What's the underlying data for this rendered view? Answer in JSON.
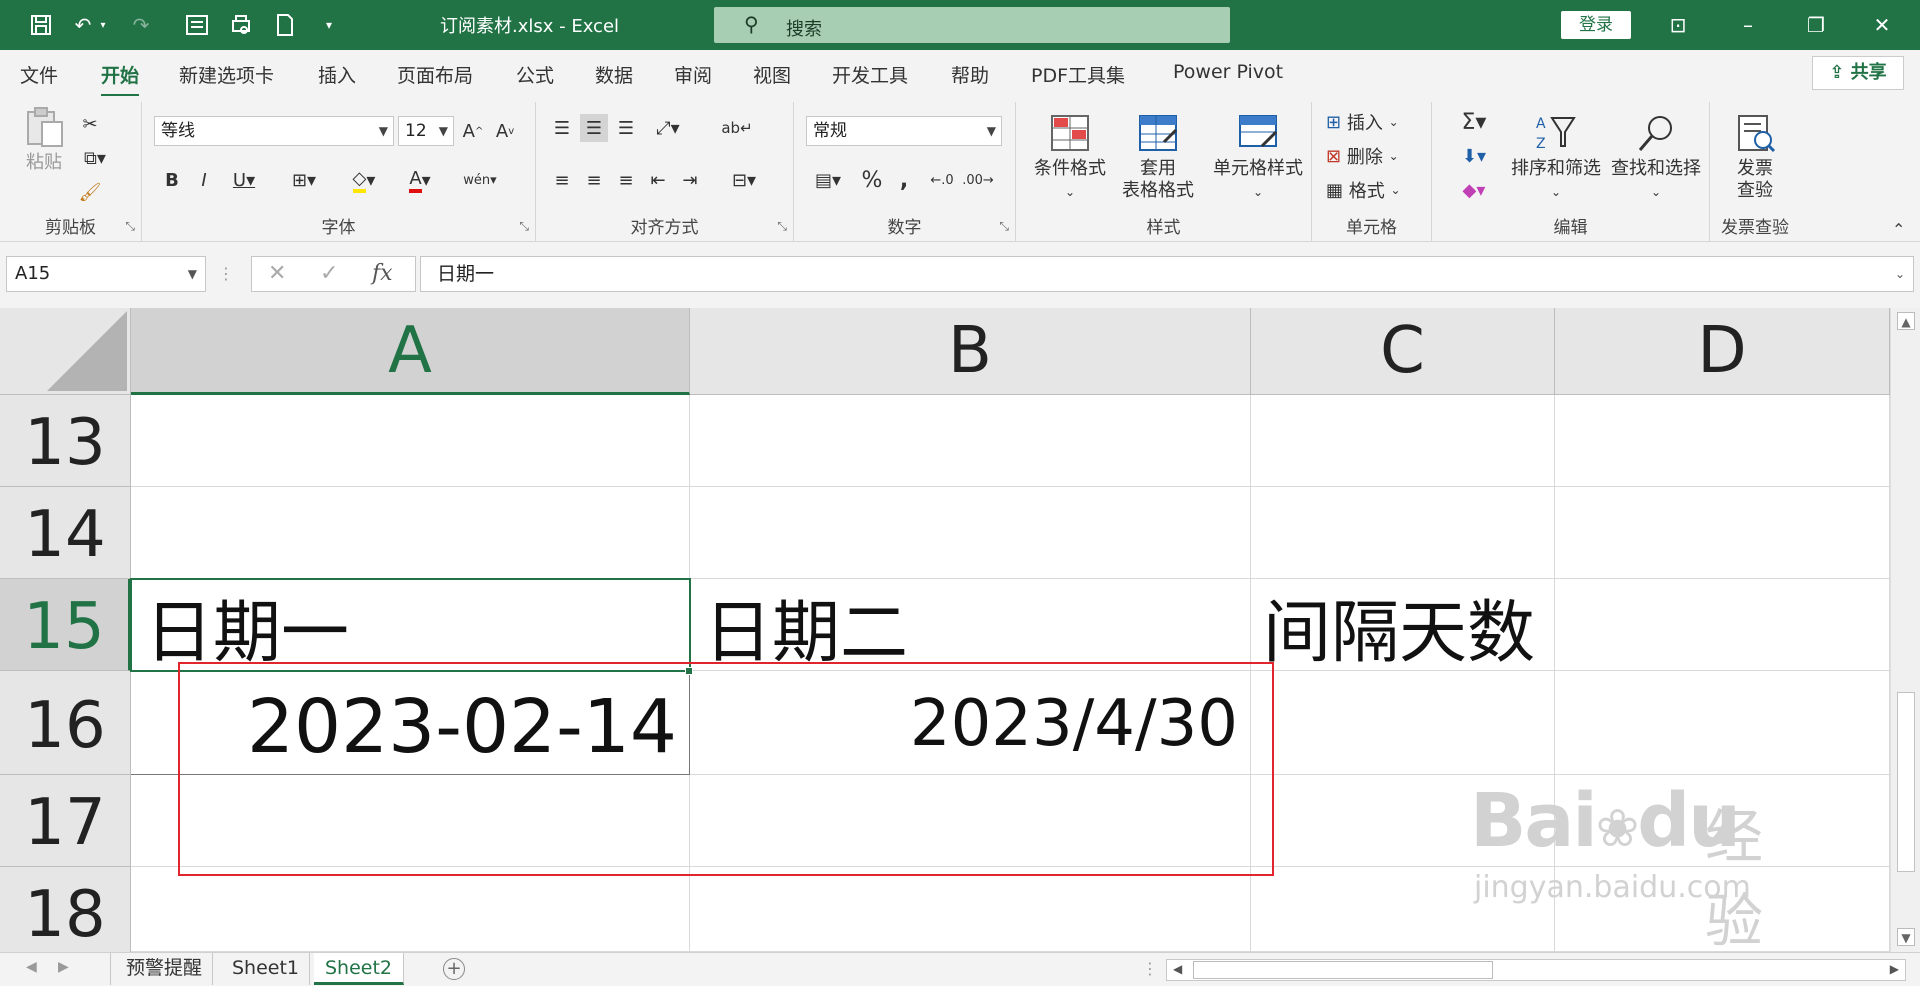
{
  "title_bar": {
    "title": "订阅素材.xlsx  -  Excel",
    "search_placeholder": "搜索",
    "login_label": "登录"
  },
  "menu": {
    "tabs": [
      "文件",
      "开始",
      "新建选项卡",
      "插入",
      "页面布局",
      "公式",
      "数据",
      "审阅",
      "视图",
      "开发工具",
      "帮助",
      "PDF工具集",
      "Power Pivot"
    ],
    "active_tab": "开始",
    "share_label": "共享"
  },
  "ribbon": {
    "clipboard": {
      "label": "剪贴板",
      "paste_label": "粘贴"
    },
    "font": {
      "label": "字体",
      "font_name": "等线",
      "font_size": "12"
    },
    "alignment": {
      "label": "对齐方式"
    },
    "number": {
      "label": "数字",
      "format": "常规"
    },
    "styles": {
      "label": "样式",
      "conditional_format": "条件格式",
      "table_format_line1": "套用",
      "table_format_line2": "表格格式",
      "cell_styles": "单元格样式"
    },
    "cells": {
      "label": "单元格",
      "insert": "插入",
      "delete": "删除",
      "format": "格式"
    },
    "editing": {
      "label": "编辑",
      "sort_filter": "排序和筛选",
      "find_select": "查找和选择"
    },
    "invoice": {
      "label": "发票查验",
      "btn_line1": "发票",
      "btn_line2": "查验"
    }
  },
  "formula_bar": {
    "name_box": "A15",
    "formula": "日期一"
  },
  "grid": {
    "columns": [
      "A",
      "B",
      "C",
      "D"
    ],
    "selected_column": "A",
    "rows": [
      "13",
      "14",
      "15",
      "16",
      "17",
      "18"
    ],
    "selected_row": "15",
    "cells": {
      "A15": "日期一",
      "B15": "日期二",
      "C15": "间隔天数",
      "A16": "2023-02-14",
      "B16": "2023/4/30"
    },
    "highlight_color": "#e0262c"
  },
  "watermark": {
    "brand": "Bai",
    "brand_mid": "du",
    "cn": "经验",
    "url": "jingyan.baidu.com"
  },
  "sheets": {
    "tabs": [
      "预警提醒",
      "Sheet1",
      "Sheet2"
    ],
    "active": "Sheet2"
  },
  "colors": {
    "accent": "#217346",
    "title_bar": "#217346"
  }
}
